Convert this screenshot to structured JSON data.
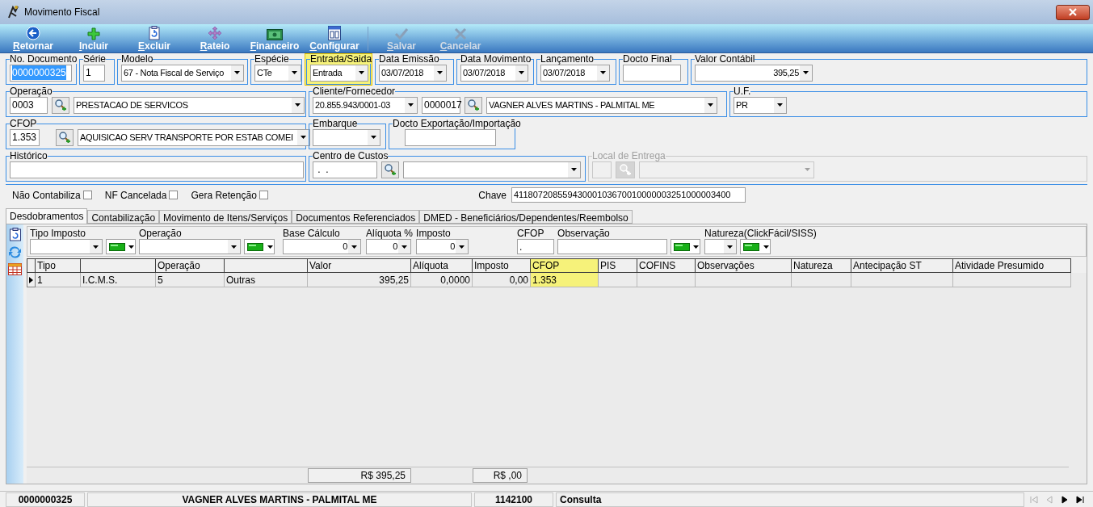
{
  "window": {
    "title": "Movimento Fiscal"
  },
  "toolbar": [
    {
      "label": "Retornar",
      "disabled": false
    },
    {
      "label": "Incluir",
      "disabled": false
    },
    {
      "label": "Excluir",
      "disabled": false
    },
    {
      "label": "Rateio",
      "disabled": false
    },
    {
      "label": "Financeiro",
      "disabled": false
    },
    {
      "label": "Configurar",
      "disabled": false
    },
    {
      "label": "Salvar",
      "disabled": true
    },
    {
      "label": "Cancelar",
      "disabled": true
    }
  ],
  "header_rows": [
    {
      "groups": [
        {
          "label": "No. Documento",
          "highlighted": false,
          "disabled": false,
          "fields": [
            {
              "kind": "text",
              "value": "0000000325",
              "focused": true
            }
          ]
        },
        {
          "label": "Série",
          "highlighted": false,
          "disabled": false,
          "fields": [
            {
              "kind": "text",
              "value": "1"
            }
          ]
        },
        {
          "label": "Modelo",
          "highlighted": false,
          "disabled": false,
          "fields": [
            {
              "kind": "select",
              "value": "67 - Nota Fiscal de Serviço"
            }
          ]
        },
        {
          "label": "Espécie",
          "highlighted": false,
          "disabled": false,
          "fields": [
            {
              "kind": "select",
              "value": "CTe"
            }
          ]
        },
        {
          "label": "Entrada/Saida",
          "highlighted": true,
          "disabled": false,
          "fields": [
            {
              "kind": "select",
              "value": "Entrada"
            }
          ]
        },
        {
          "label": "Data Emissão",
          "highlighted": false,
          "disabled": false,
          "fields": [
            {
              "kind": "select",
              "value": "03/07/2018"
            }
          ]
        },
        {
          "label": "Data Movimento",
          "highlighted": false,
          "disabled": false,
          "fields": [
            {
              "kind": "select",
              "value": "03/07/2018"
            }
          ]
        },
        {
          "label": "Lançamento",
          "highlighted": false,
          "disabled": false,
          "fields": [
            {
              "kind": "select",
              "value": "03/07/2018"
            }
          ]
        },
        {
          "label": "Docto Final",
          "highlighted": false,
          "disabled": false,
          "fields": [
            {
              "kind": "text"
            }
          ]
        },
        {
          "label": "Valor Contábil",
          "highlighted": false,
          "disabled": false,
          "fields": [
            {
              "kind": "select",
              "value": "395,25"
            }
          ]
        }
      ]
    },
    {
      "groups": [
        {
          "label": "Operação",
          "highlighted": false,
          "disabled": false,
          "fields": [
            {
              "kind": "text",
              "value": "0003"
            },
            {
              "kind": "lookup"
            },
            {
              "kind": "select",
              "value": "PRESTACAO DE SERVICOS"
            }
          ]
        },
        {
          "label": "Cliente/Fornecedor",
          "highlighted": false,
          "disabled": false,
          "fields": [
            {
              "kind": "select",
              "value": "20.855.943/0001-03"
            },
            {
              "kind": "text",
              "value": "0000017"
            },
            {
              "kind": "lookup"
            },
            {
              "kind": "select",
              "value": "VAGNER ALVES MARTINS - PALMITAL ME"
            }
          ]
        },
        {
          "label": "U.F.",
          "highlighted": false,
          "disabled": false,
          "fields": [
            {
              "kind": "select",
              "value": "PR"
            }
          ]
        }
      ]
    },
    {
      "groups": [
        {
          "label": "CFOP",
          "highlighted": false,
          "disabled": false,
          "fields": [
            {
              "kind": "text",
              "value": "1.353"
            },
            {
              "kind": "lookup"
            },
            {
              "kind": "select",
              "value": "AQUISICAO SERV TRANSPORTE POR ESTAB COMEI"
            }
          ]
        },
        {
          "label": "Embarque",
          "highlighted": false,
          "disabled": false,
          "fields": [
            {
              "kind": "select"
            }
          ]
        },
        {
          "label": "Docto Exportação/Importação",
          "highlighted": false,
          "disabled": false,
          "fields": [
            {
              "kind": "text"
            }
          ]
        }
      ]
    },
    {
      "groups": [
        {
          "label": "Histórico",
          "highlighted": false,
          "disabled": false,
          "fields": [
            {
              "kind": "text"
            }
          ]
        },
        {
          "label": "Centro de Custos",
          "highlighted": false,
          "disabled": false,
          "fields": [
            {
              "kind": "text",
              "value": " .  ."
            },
            {
              "kind": "lookup"
            },
            {
              "kind": "select"
            }
          ]
        },
        {
          "label": "Local de Entrega",
          "highlighted": false,
          "disabled": true,
          "fields": [
            {
              "kind": "text"
            },
            {
              "kind": "lookup"
            },
            {
              "kind": "select"
            }
          ]
        }
      ]
    }
  ],
  "flags": [
    {
      "label": "Não Contabiliza",
      "checked": false
    },
    {
      "label": "NF Cancelada",
      "checked": false
    },
    {
      "label": "Gera Retenção",
      "checked": false
    }
  ],
  "chave": {
    "label": "Chave",
    "value": "41180720855943000103670010000003251000003400"
  },
  "tabs": [
    {
      "label": "Desdobramentos",
      "selected": true
    },
    {
      "label": "Contabilização",
      "selected": false
    },
    {
      "label": "Movimento de Itens/Serviços",
      "selected": false
    },
    {
      "label": "Documentos Referenciados",
      "selected": false
    },
    {
      "label": "DMED - Beneficiários/Dependentes/Reembolso",
      "selected": false
    }
  ],
  "filters": [
    {
      "label": "Tipo Imposto",
      "controls": [
        {
          "kind": "select"
        },
        {
          "kind": "image-select"
        }
      ]
    },
    {
      "label": "Operação",
      "controls": [
        {
          "kind": "select"
        },
        {
          "kind": "image-select"
        }
      ]
    },
    {
      "label": "Base Cálculo",
      "controls": [
        {
          "kind": "select",
          "value": "0"
        }
      ]
    },
    {
      "label": "Alíquota %",
      "controls": [
        {
          "kind": "select",
          "value": "0"
        }
      ]
    },
    {
      "label": "Imposto",
      "controls": [
        {
          "kind": "select",
          "value": "0"
        }
      ]
    },
    {
      "label": "CFOP",
      "controls": [
        {
          "kind": "text",
          "value": "."
        }
      ]
    },
    {
      "label": "Observação",
      "controls": [
        {
          "kind": "text"
        },
        {
          "kind": "image-select"
        }
      ]
    },
    {
      "label": "Natureza(ClickFácil/SISS)",
      "controls": [
        {
          "kind": "select"
        },
        {
          "kind": "image-select"
        }
      ]
    }
  ],
  "table": {
    "columns": [
      {
        "label": "Tipo",
        "highlighted": false
      },
      {
        "highlighted": false
      },
      {
        "label": "Operação",
        "highlighted": false
      },
      {
        "highlighted": false
      },
      {
        "label": "Valor",
        "highlighted": false
      },
      {
        "label": "Alíquota",
        "highlighted": false
      },
      {
        "label": "Imposto",
        "highlighted": false
      },
      {
        "label": "CFOP",
        "highlighted": true
      },
      {
        "label": "PIS",
        "highlighted": false
      },
      {
        "label": "COFINS",
        "highlighted": false
      },
      {
        "label": "Observações",
        "highlighted": false
      },
      {
        "label": "Natureza",
        "highlighted": false
      },
      {
        "label": "Antecipação ST",
        "highlighted": false
      },
      {
        "label": "Atividade Presumido",
        "highlighted": false
      }
    ],
    "rows": [
      {
        "selected": true,
        "cells": [
          "1",
          "I.C.M.S.",
          "5",
          "Outras",
          "395,25",
          "0,0000",
          "0,00",
          "1.353"
        ]
      }
    ],
    "totals": [
      "R$ 395,25",
      "R$ ,00"
    ]
  },
  "status_bar": {
    "cells": [
      "0000000325",
      "VAGNER ALVES MARTINS - PALMITAL ME",
      "1142100",
      "Consulta"
    ],
    "nav": [
      {
        "disabled": true
      },
      {
        "disabled": true
      },
      {
        "disabled": false
      },
      {
        "disabled": false
      }
    ]
  }
}
